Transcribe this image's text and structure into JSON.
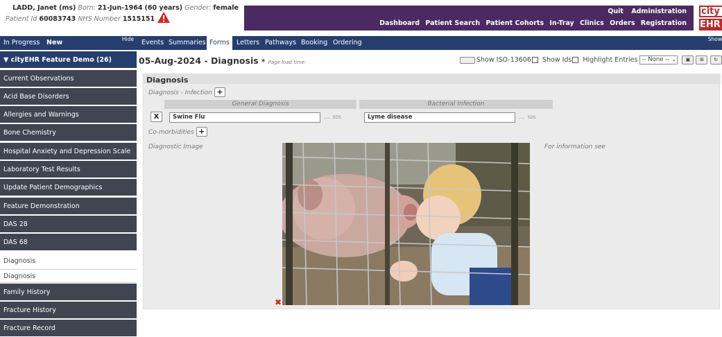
{
  "patient": {
    "name": "LADD, Janet (ms)",
    "born_label": "Born:",
    "born": "21-Jun-1964",
    "age": "(60 years)",
    "gender_label": "Gender:",
    "gender": "female",
    "patient_id_label": "Patient Id",
    "patient_id": "60083743",
    "nhs_label": "NHS Number",
    "nhs_number": "1515151"
  },
  "header": {
    "top_links": [
      "Quit",
      "Administration"
    ],
    "nav_links": [
      "Dashboard",
      "Patient Search",
      "Patient Cohorts",
      "In-Tray",
      "Clinics",
      "Orders",
      "Registration"
    ],
    "logo_top": "city",
    "logo_bottom": "EHR",
    "brand_color": "#4a2a60"
  },
  "sidebar_top": {
    "in_progress": "In Progress",
    "new": "New",
    "hide": "Hide"
  },
  "tabs": [
    {
      "label": "Events"
    },
    {
      "label": "Summaries"
    },
    {
      "label": "Forms",
      "active": true
    },
    {
      "label": "Letters"
    },
    {
      "label": "Pathways"
    },
    {
      "label": "Booking"
    },
    {
      "label": "Ordering"
    }
  ],
  "show_label": "Show",
  "sidebar": {
    "group": "▼ cityEHR Feature Demo (26)",
    "items": [
      "Current Observations",
      "Acid Base Disorders",
      "Allergies and Warnings",
      "Bone Chemistry",
      "Hospital Anxiety and Depression Scale",
      "Laboratory Test Results",
      "Update Patient Demographics",
      "Feature Demonstration",
      "DAS 28",
      "DAS 68",
      "Diagnosis",
      "Diagnosis",
      "Family History",
      "Fracture History",
      "Fracture Record"
    ]
  },
  "form": {
    "title": "05-Aug-2024 - Diagnosis",
    "modified_marker": "*",
    "page_load_label": "Page load time:",
    "show_iso": "Show ISO-13606",
    "show_ids": "Show Ids",
    "highlight": "Highlight Entries",
    "highlight_select": "-- None --",
    "section_title": "Diagnosis",
    "infection_label": "Diagnosis - Infection",
    "col_general": "General Diagnosis",
    "col_bacterial": "Bacterial Infection",
    "general_value": "Swine Flu",
    "bacterial_value": "Lyme disease",
    "suffix_dots": "...",
    "suffix_sds": "SDS",
    "comorbidities_label": "Co-morbidities",
    "diagnostic_image_label": "Diagnostic Image",
    "info_label": "For information see",
    "remove_symbol": "X",
    "add_symbol": "+"
  }
}
